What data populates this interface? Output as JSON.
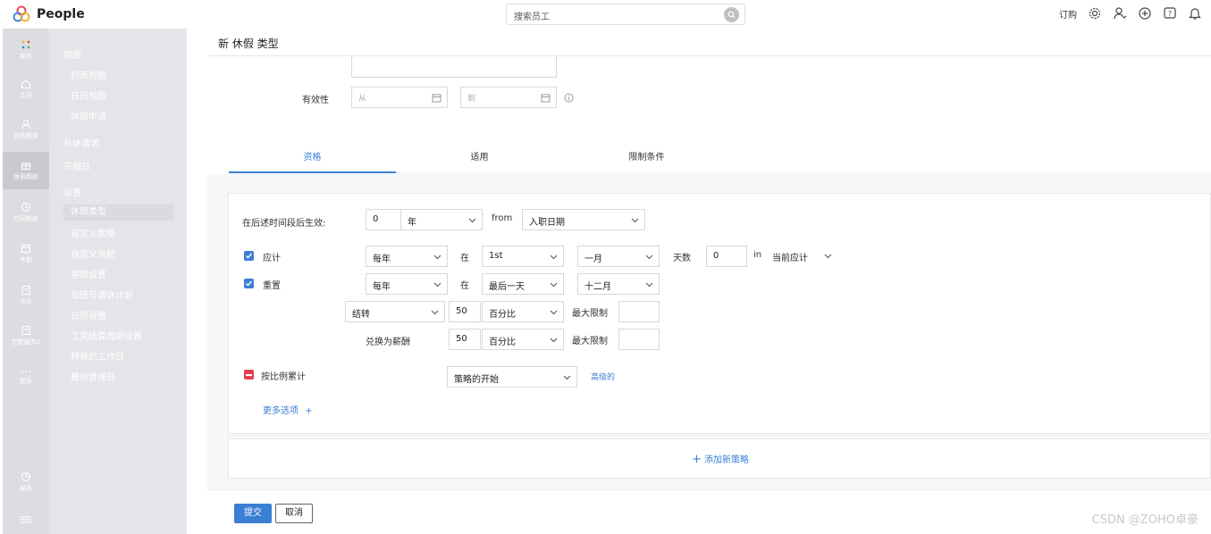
{
  "app": {
    "name": "People"
  },
  "search": {
    "placeholder": "搜索员工"
  },
  "topbar": {
    "subscribe": "订购"
  },
  "rail": [
    {
      "label": "操作",
      "icon": "dots-grid-icon"
    },
    {
      "label": "主页",
      "icon": "home-icon"
    },
    {
      "label": "自助服务",
      "icon": "user-icon"
    },
    {
      "label": "休假跟踪",
      "icon": "gift-icon"
    },
    {
      "label": "时间跟踪",
      "icon": "clock-icon"
    },
    {
      "label": "考勤",
      "icon": "calendar-icon"
    },
    {
      "label": "文件",
      "icon": "file-icon"
    },
    {
      "label": "定制服务2",
      "icon": "file-icon"
    },
    {
      "label": "更多",
      "icon": "more-icon"
    },
    {
      "label": "报表",
      "icon": "chart-icon"
    }
  ],
  "subnav": {
    "views": "视图",
    "list_view": "列表视图",
    "calendar_view": "日历视图",
    "leave_request": "休假申请",
    "comp_off": "补休请求",
    "holidays": "节假日",
    "settings": "设置",
    "leave_types": "休假类型",
    "custom_policy": "自定义策略",
    "custom_balance": "自定义余额",
    "general_settings": "常规设置",
    "overtime_plan": "加班与调休计划",
    "calendar_settings": "日历设置",
    "payroll_settings": "工资结算周期设置",
    "special_workday": "特殊的工作日",
    "module_admin": "模块管理员"
  },
  "page": {
    "title": "新 休假 类型"
  },
  "validity": {
    "label": "有效性",
    "from_placeholder": "从",
    "to_placeholder": "到"
  },
  "tabs": [
    "资格",
    "适用",
    "限制条件"
  ],
  "policy": {
    "effective_after_label": "在后述时间段后生效:",
    "effective_value": "0",
    "effective_unit": "年",
    "from_label": "from",
    "from_value": "入职日期",
    "accrual_label": "应计",
    "accrual_freq": "每年",
    "at_label": "在",
    "accrual_day": "1st",
    "accrual_month": "一月",
    "days_label": "天数",
    "days_value": "0",
    "in_label": "in",
    "in_value": "当前应计",
    "reset_label": "重置",
    "reset_freq": "每年",
    "reset_day": "最后一天",
    "reset_month": "十二月",
    "carry_type": "结转",
    "carry_value": "50",
    "carry_unit": "百分比",
    "max_limit_label": "最大限制",
    "encash_label": "兑换为薪酬",
    "encash_value": "50",
    "encash_unit": "百分比",
    "prorate_label": "按比例累计",
    "prorate_value": "策略的开始",
    "advanced_link": "高级的",
    "more_options": "更多选项"
  },
  "add_policy": "添加新策略",
  "footer": {
    "submit": "提交",
    "cancel": "取消"
  },
  "watermark": "CSDN @ZOHO卓豪",
  "colors": {
    "accent": "#3b7fd4",
    "danger": "#e2414c"
  }
}
